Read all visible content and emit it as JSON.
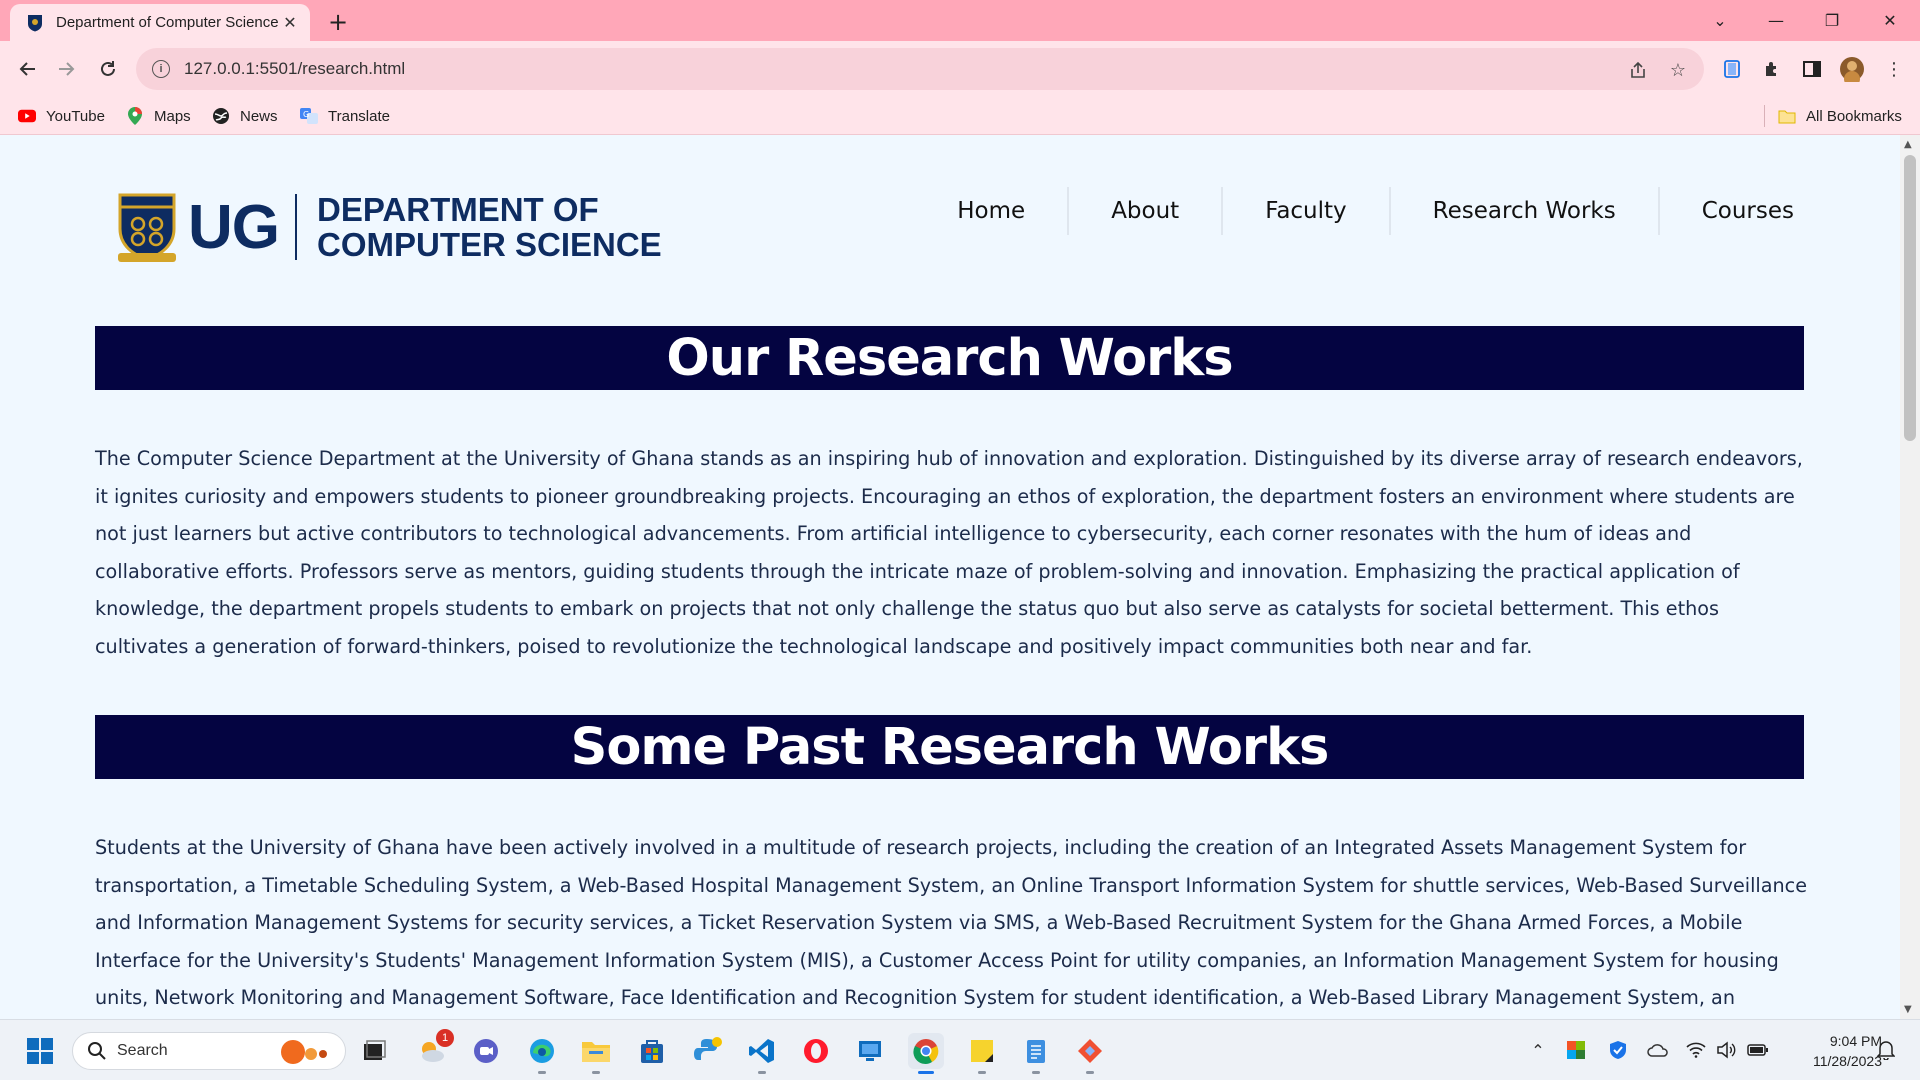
{
  "browser": {
    "tab": {
      "title": "Department of Computer Science",
      "close": "✕"
    },
    "new_tab": "+",
    "window_controls": {
      "tab_search": "⌄",
      "minimize": "—",
      "restore": "❐",
      "close": "✕"
    },
    "address": "127.0.0.1:5501/research.html",
    "bookmarks": [
      {
        "label": "YouTube",
        "icon": "youtube-icon"
      },
      {
        "label": "Maps",
        "icon": "maps-icon"
      },
      {
        "label": "News",
        "icon": "news-icon"
      },
      {
        "label": "Translate",
        "icon": "translate-icon"
      }
    ],
    "all_bookmarks": "All Bookmarks"
  },
  "site": {
    "logo_ug": "UG",
    "logo_line1": "DEPARTMENT OF",
    "logo_line2": "COMPUTER SCIENCE",
    "nav": [
      "Home",
      "About",
      "Faculty",
      "Research Works",
      "Courses"
    ]
  },
  "content": {
    "heading1": "Our Research Works",
    "paragraph1": "The Computer Science Department at the University of Ghana stands as an inspiring hub of innovation and exploration. Distinguished by its diverse array of research endeavors, it ignites curiosity and empowers students to pioneer groundbreaking projects. Encouraging an ethos of exploration, the department fosters an environment where students are not just learners but active contributors to technological advancements. From artificial intelligence to cybersecurity, each corner resonates with the hum of ideas and collaborative efforts. Professors serve as mentors, guiding students through the intricate maze of problem-solving and innovation. Emphasizing the practical application of knowledge, the department propels students to embark on projects that not only challenge the status quo but also serve as catalysts for societal betterment. This ethos cultivates a generation of forward-thinkers, poised to revolutionize the technological landscape and positively impact communities both near and far.",
    "heading2": "Some Past Research Works",
    "paragraph2": "Students at the University of Ghana have been actively involved in a multitude of research projects, including the creation of an Integrated Assets Management System for transportation, a Timetable Scheduling System, a Web-Based Hospital Management System, an Online Transport Information System for shuttle services, Web-Based Surveillance and Information Management Systems for security services, a Ticket Reservation System via SMS, a Web-Based Recruitment System for the Ghana Armed Forces, a Mobile Interface for the University's Students' Management Information System (MIS), a Customer Access Point for utility companies, an Information Management System for housing units, Network Monitoring and Management Software, Face Identification and Recognition System for student identification, a Web-Based Library Management System, an Employee Appraisal"
  },
  "taskbar": {
    "search_label": "Search",
    "weather_badge": "1",
    "time": "9:04 PM",
    "date": "11/28/2023"
  },
  "colors": {
    "tab_strip": "#ffa7b8",
    "toolbar": "#ffe4ea",
    "page_bg": "#f0f8ff",
    "banner_bg": "#040441",
    "brand_navy": "#0e2c61"
  }
}
